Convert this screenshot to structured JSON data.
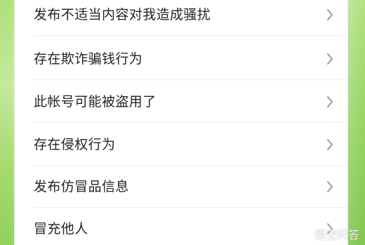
{
  "report_menu": {
    "items": [
      {
        "label": "发布不适当内容对我造成骚扰"
      },
      {
        "label": "存在欺诈骗钱行为"
      },
      {
        "label": "此帐号可能被盗用了"
      },
      {
        "label": "存在侵权行为"
      },
      {
        "label": "发布仿冒品信息"
      },
      {
        "label": "冒充他人"
      }
    ],
    "icons": {
      "chevron": "chevron-right-icon"
    }
  },
  "watermark": {
    "text": "悟空问答"
  },
  "colors": {
    "accent_green": "#a7dc73",
    "text": "#242424",
    "chevron": "#9a9a9a",
    "divider": "#efefef"
  }
}
